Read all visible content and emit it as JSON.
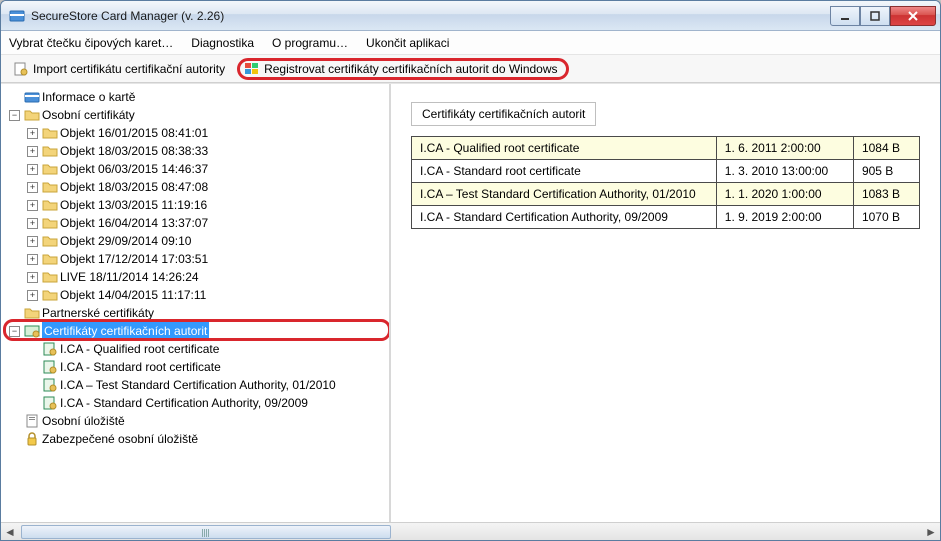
{
  "window": {
    "title": "SecureStore Card Manager (v. 2.26)"
  },
  "menubar": {
    "items": [
      "Vybrat čtečku čipových karet…",
      "Diagnostika",
      "O programu…",
      "Ukončit aplikaci"
    ]
  },
  "toolbar": {
    "import_label": "Import certifikátu certifikační autority",
    "register_label": "Registrovat certifikáty certifikačních autorit do Windows"
  },
  "tree": {
    "root_info": "Informace o kartě",
    "personal": "Osobní certifikáty",
    "objects": [
      "Objekt 16/01/2015 08:41:01",
      "Objekt 18/03/2015 08:38:33",
      "Objekt 06/03/2015 14:46:37",
      "Objekt 18/03/2015 08:47:08",
      "Objekt 13/03/2015 11:19:16",
      "Objekt 16/04/2014 13:37:07",
      "Objekt 29/09/2014 09:10",
      "Objekt 17/12/2014 17:03:51",
      "LIVE 18/11/2014 14:26:24",
      "Objekt 14/04/2015 11:17:11"
    ],
    "partner": "Partnerské certifikáty",
    "ca": "Certifikáty certifikačních autorit",
    "ca_items": [
      "I.CA - Qualified root certificate",
      "I.CA - Standard root certificate",
      "I.CA – Test Standard Certification Authority, 01/2010",
      "I.CA - Standard Certification Authority, 09/2009"
    ],
    "personal_store": "Osobní úložiště",
    "secure_store": "Zabezpečené osobní úložiště"
  },
  "detail": {
    "group_title": "Certifikáty certifikačních autorit",
    "rows": [
      {
        "name": "I.CA - Qualified root certificate",
        "date": "1. 6. 2011 2:00:00",
        "size": "1084 B"
      },
      {
        "name": "I.CA - Standard root certificate",
        "date": "1. 3. 2010 13:00:00",
        "size": "905 B"
      },
      {
        "name": "I.CA – Test Standard Certification Authority, 01/2010",
        "date": "1. 1. 2020 1:00:00",
        "size": "1083 B"
      },
      {
        "name": "I.CA - Standard Certification Authority, 09/2009",
        "date": "1. 9. 2019 2:00:00",
        "size": "1070 B"
      }
    ]
  }
}
